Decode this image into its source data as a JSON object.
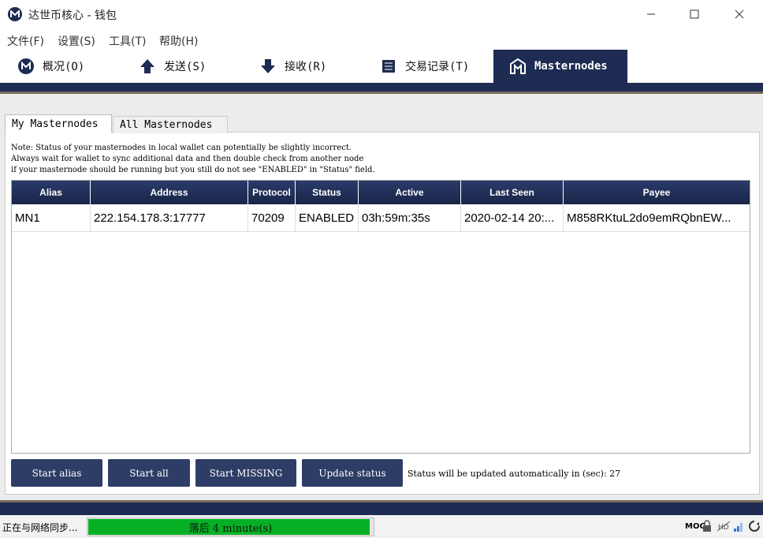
{
  "window": {
    "title": "达世币核心 - 钱包"
  },
  "menu": [
    "文件(F)",
    "设置(S)",
    "工具(T)",
    "帮助(H)"
  ],
  "tabs": [
    {
      "label": "概况(O)",
      "icon": "overview-icon"
    },
    {
      "label": "发送(S)",
      "icon": "send-arrow-icon"
    },
    {
      "label": "接收(R)",
      "icon": "receive-arrow-icon"
    },
    {
      "label": "交易记录(T)",
      "icon": "transactions-list-icon"
    },
    {
      "label": "Masternodes",
      "icon": "masternodes-icon"
    }
  ],
  "subtabs": {
    "my": "My Masternodes",
    "all": "All Masternodes"
  },
  "note": "Note: Status of your masternodes in local wallet can potentially be slightly incorrect.\nAlways wait for wallet to sync additional data and then double check from another node\nif your masternode should be running but you still do not see \"ENABLED\" in \"Status\" field.",
  "table": {
    "headers": [
      "Alias",
      "Address",
      "Protocol",
      "Status",
      "Active",
      "Last Seen",
      "Payee"
    ],
    "rows": [
      [
        "MN1",
        "222.154.178.3:17777",
        "70209",
        "ENABLED",
        "03h:59m:35s",
        "2020-02-14 20:...",
        "M858RKtuL2do9emRQbnEW..."
      ]
    ]
  },
  "buttons": {
    "start_alias": "Start alias",
    "start_all": "Start all",
    "start_missing": "Start MISSING",
    "update_status": "Update status"
  },
  "auto_update_text": "Status will be updated automatically in (sec): 27",
  "statusbar": {
    "sync_label": "正在与网络同步...",
    "progress_text": "落后 4 minute(s)",
    "progress_fraction": 0.99,
    "unit": "MOG"
  },
  "colors": {
    "navy": "#1e2b52",
    "progress_green": "#06b025",
    "button": "#2e3d66"
  }
}
